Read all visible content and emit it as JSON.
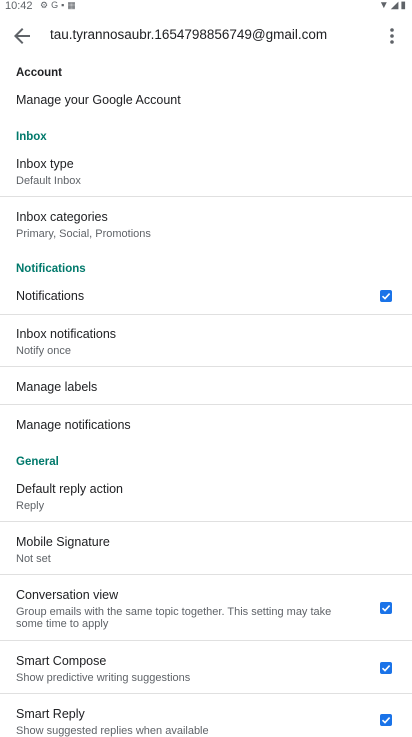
{
  "status_bar": {
    "time": "10:42",
    "left_icons": [
      "settings-gear-icon",
      "google-g-icon",
      "sim-icon",
      "calendar-icon"
    ],
    "right_icons": [
      "wifi-icon",
      "signal-icon",
      "battery-icon"
    ]
  },
  "app_bar": {
    "title": "tau.tyrannosaubr.1654798856749@gmail.com"
  },
  "sections": {
    "account": "Account",
    "inbox": "Inbox",
    "notifications": "Notifications",
    "general": "General"
  },
  "items": {
    "manage_google_account": {
      "label": "Manage your Google Account"
    },
    "inbox_type": {
      "label": "Inbox type",
      "sub": "Default Inbox"
    },
    "inbox_categories": {
      "label": "Inbox categories",
      "sub": "Primary, Social, Promotions"
    },
    "notifications": {
      "label": "Notifications",
      "checked": true
    },
    "inbox_notifications": {
      "label": "Inbox notifications",
      "sub": "Notify once"
    },
    "manage_labels": {
      "label": "Manage labels"
    },
    "manage_notifications": {
      "label": "Manage notifications"
    },
    "default_reply_action": {
      "label": "Default reply action",
      "sub": "Reply"
    },
    "mobile_signature": {
      "label": "Mobile Signature",
      "sub": "Not set"
    },
    "conversation_view": {
      "label": "Conversation view",
      "sub": "Group emails with the same topic together. This setting may take some time to apply",
      "checked": true
    },
    "smart_compose": {
      "label": "Smart Compose",
      "sub": "Show predictive writing suggestions",
      "checked": true
    },
    "smart_reply": {
      "label": "Smart Reply",
      "sub": "Show suggested replies when available",
      "checked": true
    }
  },
  "colors": {
    "accent_teal": "#00796b",
    "checkbox_blue": "#1a73e8"
  }
}
